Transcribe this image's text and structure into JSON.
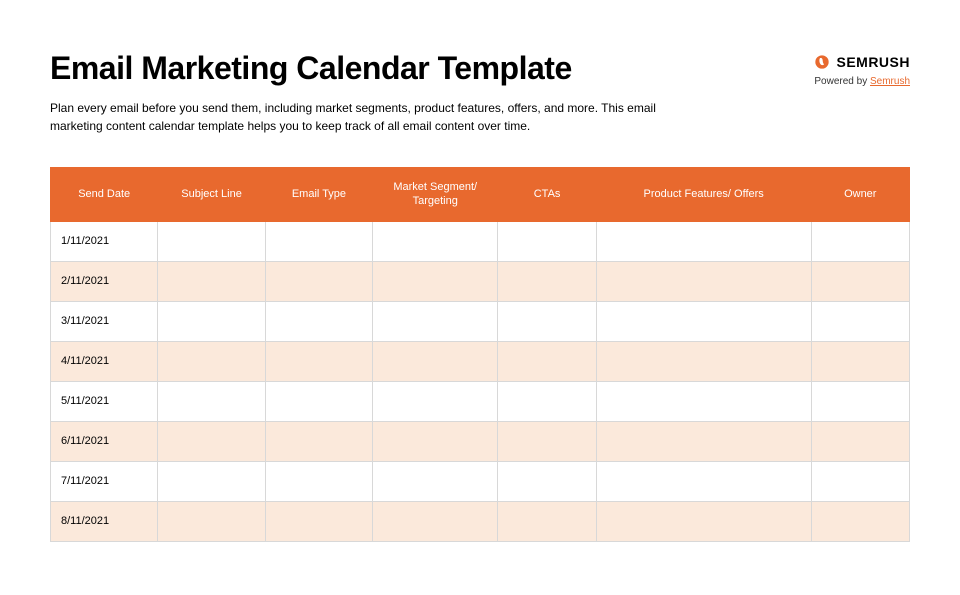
{
  "header": {
    "title": "Email Marketing Calendar Template",
    "brand_name": "SEMRUSH",
    "powered_by_label": "Powered by ",
    "powered_by_link": "Semrush"
  },
  "description": "Plan every email before you send them, including market segments, product features, offers, and more. This email marketing content calendar template helps you to keep track of all email content over time.",
  "table": {
    "headers": {
      "send_date": "Send Date",
      "subject_line": "Subject Line",
      "email_type": "Email Type",
      "market_segment": "Market Segment/ Targeting",
      "ctas": "CTAs",
      "product_features": "Product Features/ Offers",
      "owner": "Owner"
    },
    "rows": [
      {
        "send_date": "1/11/2021",
        "subject_line": "",
        "email_type": "",
        "market_segment": "",
        "ctas": "",
        "product_features": "",
        "owner": ""
      },
      {
        "send_date": "2/11/2021",
        "subject_line": "",
        "email_type": "",
        "market_segment": "",
        "ctas": "",
        "product_features": "",
        "owner": ""
      },
      {
        "send_date": "3/11/2021",
        "subject_line": "",
        "email_type": "",
        "market_segment": "",
        "ctas": "",
        "product_features": "",
        "owner": ""
      },
      {
        "send_date": "4/11/2021",
        "subject_line": "",
        "email_type": "",
        "market_segment": "",
        "ctas": "",
        "product_features": "",
        "owner": ""
      },
      {
        "send_date": "5/11/2021",
        "subject_line": "",
        "email_type": "",
        "market_segment": "",
        "ctas": "",
        "product_features": "",
        "owner": ""
      },
      {
        "send_date": "6/11/2021",
        "subject_line": "",
        "email_type": "",
        "market_segment": "",
        "ctas": "",
        "product_features": "",
        "owner": ""
      },
      {
        "send_date": "7/11/2021",
        "subject_line": "",
        "email_type": "",
        "market_segment": "",
        "ctas": "",
        "product_features": "",
        "owner": ""
      },
      {
        "send_date": "8/11/2021",
        "subject_line": "",
        "email_type": "",
        "market_segment": "",
        "ctas": "",
        "product_features": "",
        "owner": ""
      }
    ]
  },
  "brand_color": "#e8692e"
}
